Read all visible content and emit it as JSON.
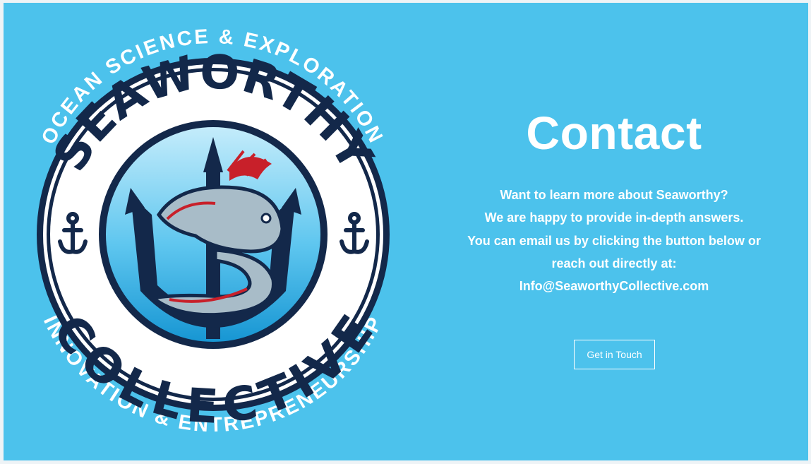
{
  "logo": {
    "arc_top": "OCEAN SCIENCE & EXPLORATION",
    "arc_bottom": "INNOVATION & ENTREPRENEURSHIP",
    "ring_top": "SEAWORTHY",
    "ring_bottom": "COLLECTIVE"
  },
  "contact": {
    "heading": "Contact",
    "lines": [
      "Want to learn more about Seaworthy?",
      "We are happy to provide in-depth answers.",
      "You can email us by clicking the button below or",
      "reach out directly at:",
      "Info@SeaworthyCollective.com"
    ],
    "button_label": "Get in Touch"
  },
  "colors": {
    "background": "#4cc2ec",
    "navy": "#13284a",
    "white": "#ffffff",
    "accent_red": "#c8202a"
  }
}
